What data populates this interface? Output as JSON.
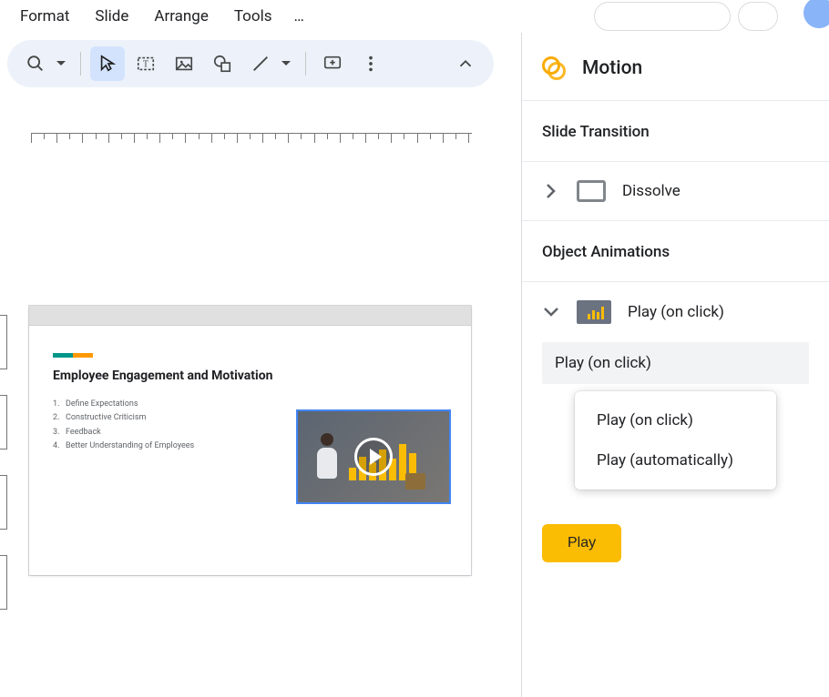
{
  "menubar": {
    "items": [
      "Format",
      "Slide",
      "Arrange",
      "Tools"
    ],
    "ellipsis": "…"
  },
  "toolbar": {
    "tools": [
      "zoom",
      "select",
      "textbox",
      "image",
      "shape",
      "line",
      "comment",
      "more",
      "collapse"
    ]
  },
  "slide": {
    "title": "Employee Engagement and Motivation",
    "list": [
      "Define Expectations",
      "Constructive Criticism",
      "Feedback",
      "Better Understanding of Employees"
    ]
  },
  "panel": {
    "title": "Motion",
    "sections": {
      "transition_title": "Slide Transition",
      "transition_value": "Dissolve",
      "animations_title": "Object Animations",
      "animation_value": "Play (on click)"
    },
    "dropdown": {
      "selected": "Play (on click)",
      "options": [
        "Play (on click)",
        "Play (automatically)"
      ]
    },
    "play_button": "Play"
  }
}
